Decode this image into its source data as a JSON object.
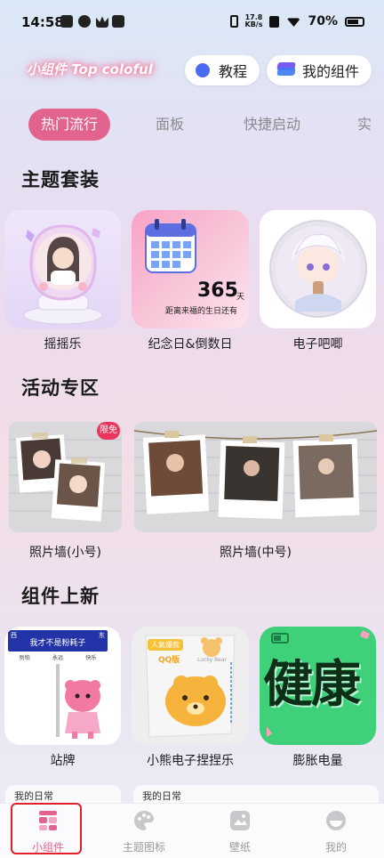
{
  "status_bar": {
    "time": "14:58",
    "net_speed": "17.8",
    "net_unit": "KB/s",
    "battery": "70%"
  },
  "header": {
    "brand": "小组件 Top coloful",
    "tutorial_label": "教程",
    "my_widgets_label": "我的组件"
  },
  "tabs": [
    "热门流行",
    "面板",
    "快捷启动",
    "实"
  ],
  "sections": {
    "theme_suite": {
      "title": "主题套装",
      "items": [
        "摇摇乐",
        "纪念日&倒数日",
        "电子吧唧"
      ],
      "calendar_days": "365",
      "calendar_unit": "天",
      "calendar_caption": "距离来福的生日还有"
    },
    "activity": {
      "title": "活动专区",
      "items": [
        "照片墙(小号)",
        "照片墙(中号)"
      ],
      "free_badge": "限免"
    },
    "new_widgets": {
      "title": "组件上新",
      "items": [
        "站牌",
        "小熊电子捏捏乐",
        "膨胀电量"
      ],
      "sign_title": "我才不是粉耗子",
      "sign_left": "西",
      "sign_right": "东",
      "sign_stops": [
        "别怕",
        "永远",
        "快乐"
      ],
      "bear_tag": "人氣爆款",
      "bear_sub": "QQ版",
      "bear_mini": "Lucky Bear",
      "health_text": "健康"
    }
  },
  "peek": {
    "left": "我的日常",
    "right": "我的日常"
  },
  "bottom_nav": [
    {
      "label": "小组件",
      "icon": "widget-icon",
      "active": true
    },
    {
      "label": "主题图标",
      "icon": "palette-icon",
      "active": false
    },
    {
      "label": "壁纸",
      "icon": "wallpaper-icon",
      "active": false
    },
    {
      "label": "我的",
      "icon": "profile-icon",
      "active": false
    }
  ],
  "colors": {
    "accent": "#e2638d",
    "highlight": "#e0212a",
    "health_green": "#3fd17a"
  }
}
